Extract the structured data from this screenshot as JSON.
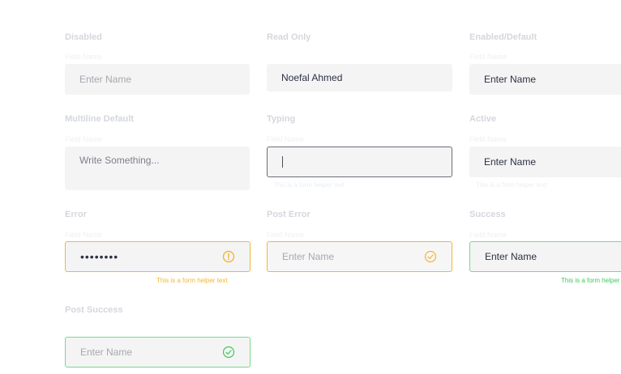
{
  "states": {
    "disabled": {
      "title": "Disabled",
      "label": "Field Name",
      "placeholder": "Enter Name"
    },
    "read_only": {
      "title": "Read Only",
      "value": "Noefal Ahmed"
    },
    "enabled": {
      "title": "Enabled/Default",
      "label": "Field Name",
      "placeholder": "Enter Name"
    },
    "multiline": {
      "title": "Multiline Default",
      "label": "Field Name",
      "placeholder": "Write Something..."
    },
    "typing": {
      "title": "Typing",
      "label": "Field Name",
      "helper": "This is a form helper text"
    },
    "active": {
      "title": "Active",
      "label": "Field Name",
      "value": "Enter Name",
      "helper": "This is a form helper text"
    },
    "error": {
      "title": "Error",
      "label": "Field Name",
      "masked_value": "••••••••",
      "helper": "This is a form helper text"
    },
    "post_error": {
      "title": "Post Error",
      "label": "Field Name",
      "placeholder": "Enter Name"
    },
    "success": {
      "title": "Success",
      "label": "Field Name",
      "value": "Enter Name",
      "helper": "This is a form helper text"
    },
    "post_success": {
      "title": "Post Success",
      "placeholder": "Enter Name"
    }
  },
  "icons": {
    "error": "warning-circle-icon",
    "post_error": "check-circle-icon",
    "post_success": "check-circle-icon"
  },
  "colors": {
    "warning": "#f4b632",
    "success": "#3ec95a",
    "success_border": "#7ad98c",
    "typing_border": "#6b6f78"
  }
}
